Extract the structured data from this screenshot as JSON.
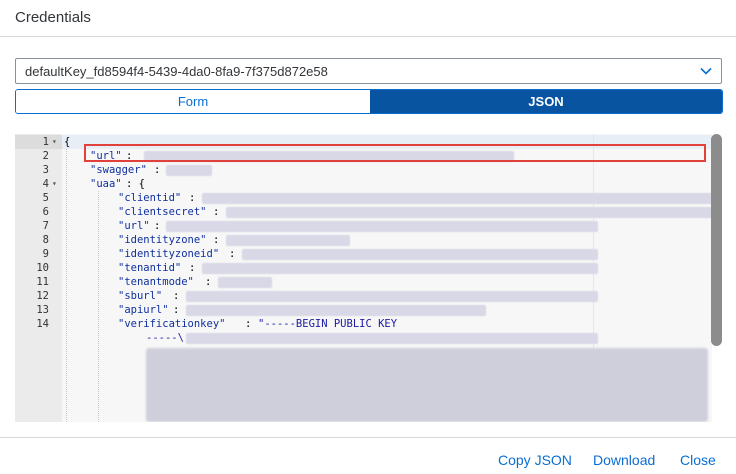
{
  "dialog": {
    "title": "Credentials"
  },
  "key_select": {
    "value": "defaultKey_fd8594f4-5439-4da0-8fa9-7f375d872e58",
    "icon": "chevron-down-icon"
  },
  "view_toggle": {
    "form_label": "Form",
    "json_label": "JSON",
    "selected": "JSON"
  },
  "editor": {
    "line_numbers": [
      "1",
      "2",
      "3",
      "4",
      "5",
      "6",
      "7",
      "8",
      "9",
      "10",
      "11",
      "12",
      "13",
      "14"
    ],
    "lines": {
      "l1": "{",
      "l2_key": "\"url\"",
      "l3_key": "\"swagger\"",
      "l4_key": "\"uaa\"",
      "l4_rest": ": {",
      "l5_key": "\"clientid\"",
      "l6_key": "\"clientsecret\"",
      "l7_key": "\"url\"",
      "l8_key": "\"identityzone\"",
      "l9_key": "\"identityzoneid\"",
      "l10_key": "\"tenantid\"",
      "l11_key": "\"tenantmode\"",
      "l12_key": "\"sburl\"",
      "l13_key": "\"apiurl\"",
      "l14_key": "\"verificationkey\"",
      "l14_val": "\"-----BEGIN PUBLIC KEY",
      "l14_cont": "-----\\"
    },
    "colon": ":"
  },
  "footer": {
    "copy_label": "Copy JSON",
    "download_label": "Download",
    "close_label": "Close"
  },
  "colors": {
    "accent": "#0a6ed1",
    "selected_bg": "#0854a0",
    "highlight": "#e2403b"
  }
}
